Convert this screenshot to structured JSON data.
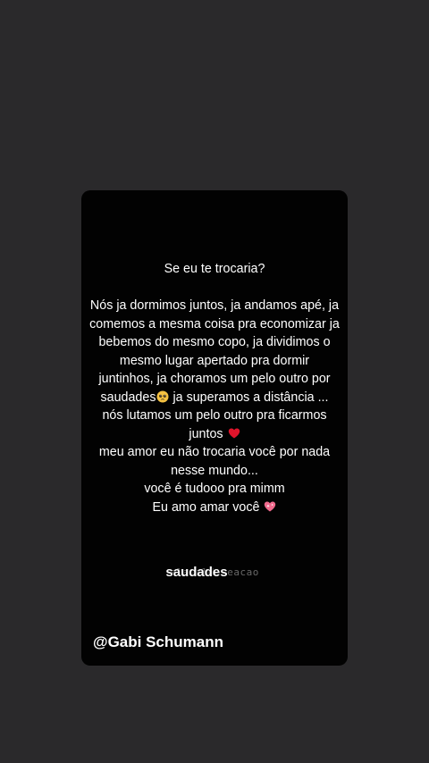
{
  "story": {
    "lines_before": [
      "Se eu te trocaria?"
    ],
    "lines": [
      "Nós ja dormimos juntos, ja andamos apé, ja",
      "comemos a mesma coisa pra economizar ja",
      "bebemos do mesmo copo, ja dividimos o",
      "mesmo lugar apertado pra dormir",
      "juntinhos, ja choramos um pelo outro por",
      "saudades",
      "ja superamos a distância ...",
      "nós lutamos um pelo outro pra ficarmos",
      "juntos",
      "meu amor eu não trocaria você por nada",
      "nesse mundo...",
      "você é tudooo pra mimm",
      "Eu amo amar você"
    ],
    "emoji": {
      "pleading": "pleading-face-icon",
      "heart": "red-heart-icon",
      "sparkle_heart": "sparkling-heart-icon"
    }
  },
  "watermark": {
    "ghost_text": "alamaldeseacao",
    "bold_text": "saudades"
  },
  "author": {
    "handle": "@Gabi Schumann"
  },
  "colors": {
    "background": "#2a292b",
    "card": "#020202",
    "text": "#ffffff",
    "heart": "#e0142b",
    "sparkle_heart": "#f06a8d"
  }
}
